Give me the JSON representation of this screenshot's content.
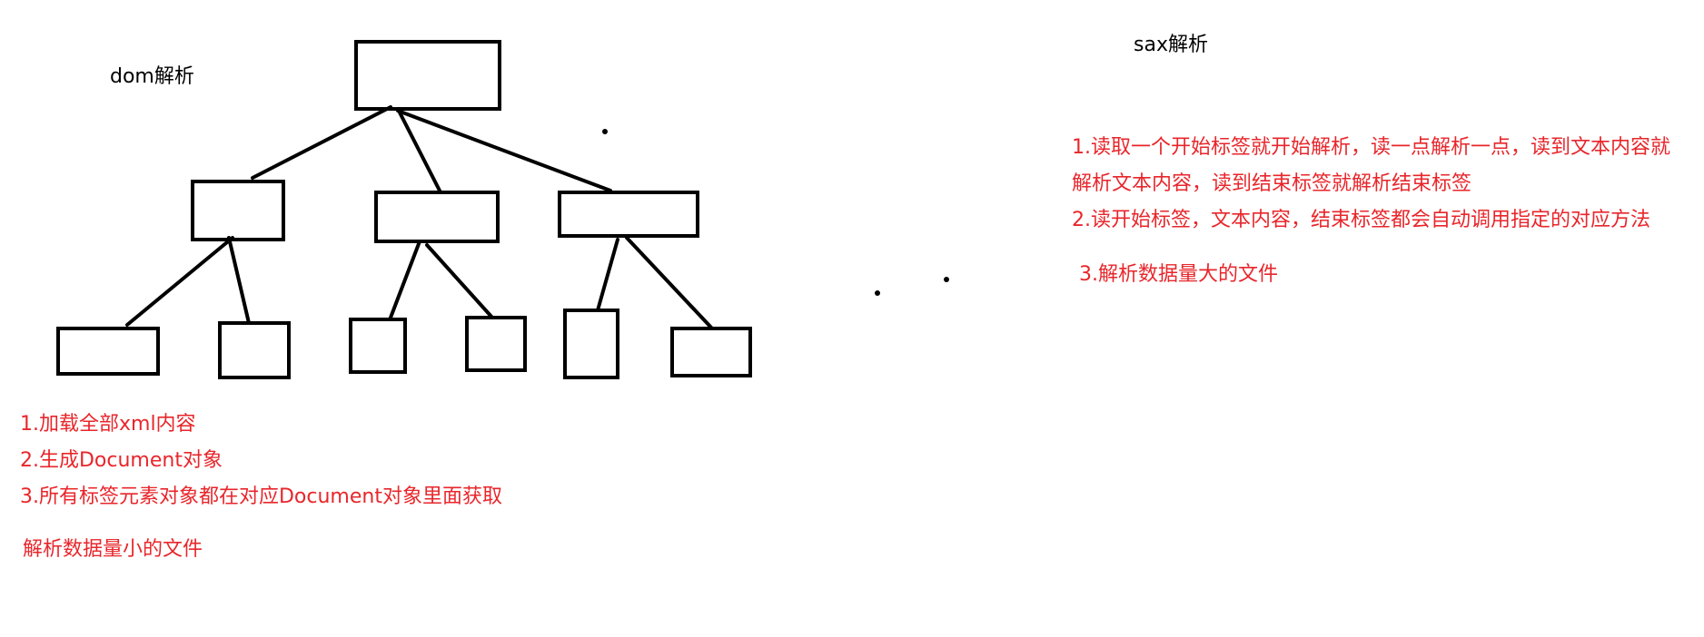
{
  "dom_section": {
    "title": "dom解析",
    "notes": [
      "1.加载全部xml内容",
      "2.生成Document对象",
      "3.所有标签元素对象都在对应Document对象里面获取"
    ],
    "summary": "解析数据量小的文件"
  },
  "sax_section": {
    "title": "sax解析",
    "notes": [
      "1.读取一个开始标签就开始解析，读一点解析一点，读到文本内容就",
      "解析文本内容，读到结束标签就解析结束标签",
      "2.读开始标签，文本内容，结束标签都会自动调用指定的对应方法"
    ],
    "summary": "3.解析数据量大的文件"
  },
  "colors": {
    "note_text": "#e8262b",
    "heading_text": "#000000",
    "stroke": "#000000",
    "background": "#ffffff"
  }
}
